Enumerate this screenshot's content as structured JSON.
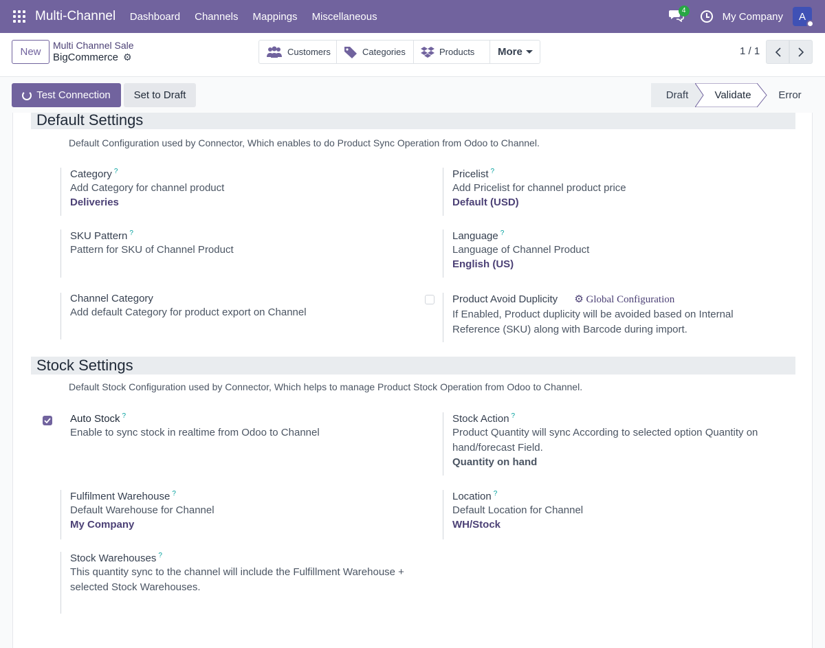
{
  "navbar": {
    "brand": "Multi-Channel",
    "menu": [
      "Dashboard",
      "Channels",
      "Mappings",
      "Miscellaneous"
    ],
    "chat_count": "4",
    "company": "My Company",
    "avatar_initial": "A",
    "color": "#71639e"
  },
  "control": {
    "new_label": "New",
    "breadcrumb_parent": "Multi Channel Sale",
    "breadcrumb_current": "BigCommerce",
    "smart_buttons": [
      "Customers",
      "Categories",
      "Products",
      "More"
    ],
    "pager": "1 / 1"
  },
  "status": {
    "test_label": "Test Connection",
    "draft_label": "Set to Draft",
    "stages": [
      "Draft",
      "Validate",
      "Error"
    ],
    "active_stage": "Validate"
  },
  "default_settings": {
    "title": "Default Settings",
    "desc": "Default Configuration used by Connector, Which enables to do Product Sync Operation from Odoo to Channel.",
    "category": {
      "label": "Category",
      "help": "Add Category for channel product",
      "value": "Deliveries"
    },
    "pricelist": {
      "label": "Pricelist",
      "help": "Add Pricelist for channel product price",
      "value": "Default (USD)"
    },
    "sku": {
      "label": "SKU Pattern",
      "help": "Pattern for SKU of Channel Product"
    },
    "language": {
      "label": "Language",
      "help": "Language of Channel Product",
      "value": "English (US)"
    },
    "channel_category": {
      "label": "Channel Category",
      "help": "Add default Category for product export on Channel"
    },
    "avoid_dup": {
      "label": "Product Avoid Duplicity",
      "link": "Global Configuration",
      "help": "If Enabled, Product duplicity will be avoided based on Internal Reference (SKU) along with Barcode during import.",
      "checked": false
    }
  },
  "stock_settings": {
    "title": "Stock Settings",
    "desc": "Default Stock Configuration used by Connector, Which helps to manage Product Stock Operation from Odoo to Channel.",
    "auto_stock": {
      "label": "Auto Stock",
      "help": "Enable to sync stock in realtime from Odoo to Channel",
      "checked": true
    },
    "stock_action": {
      "label": "Stock Action",
      "help": "Product Quantity will sync According to selected option Quantity on hand/forecast Field.",
      "value": "Quantity on hand"
    },
    "fulfilment": {
      "label": "Fulfilment Warehouse",
      "help": "Default Warehouse for Channel",
      "value": "My Company"
    },
    "location": {
      "label": "Location",
      "help": "Default Location for Channel",
      "value": "WH/Stock"
    },
    "stock_wh": {
      "label": "Stock Warehouses",
      "help": "This quantity sync to the channel will include the Fulfillment Warehouse + selected Stock Warehouses."
    }
  }
}
